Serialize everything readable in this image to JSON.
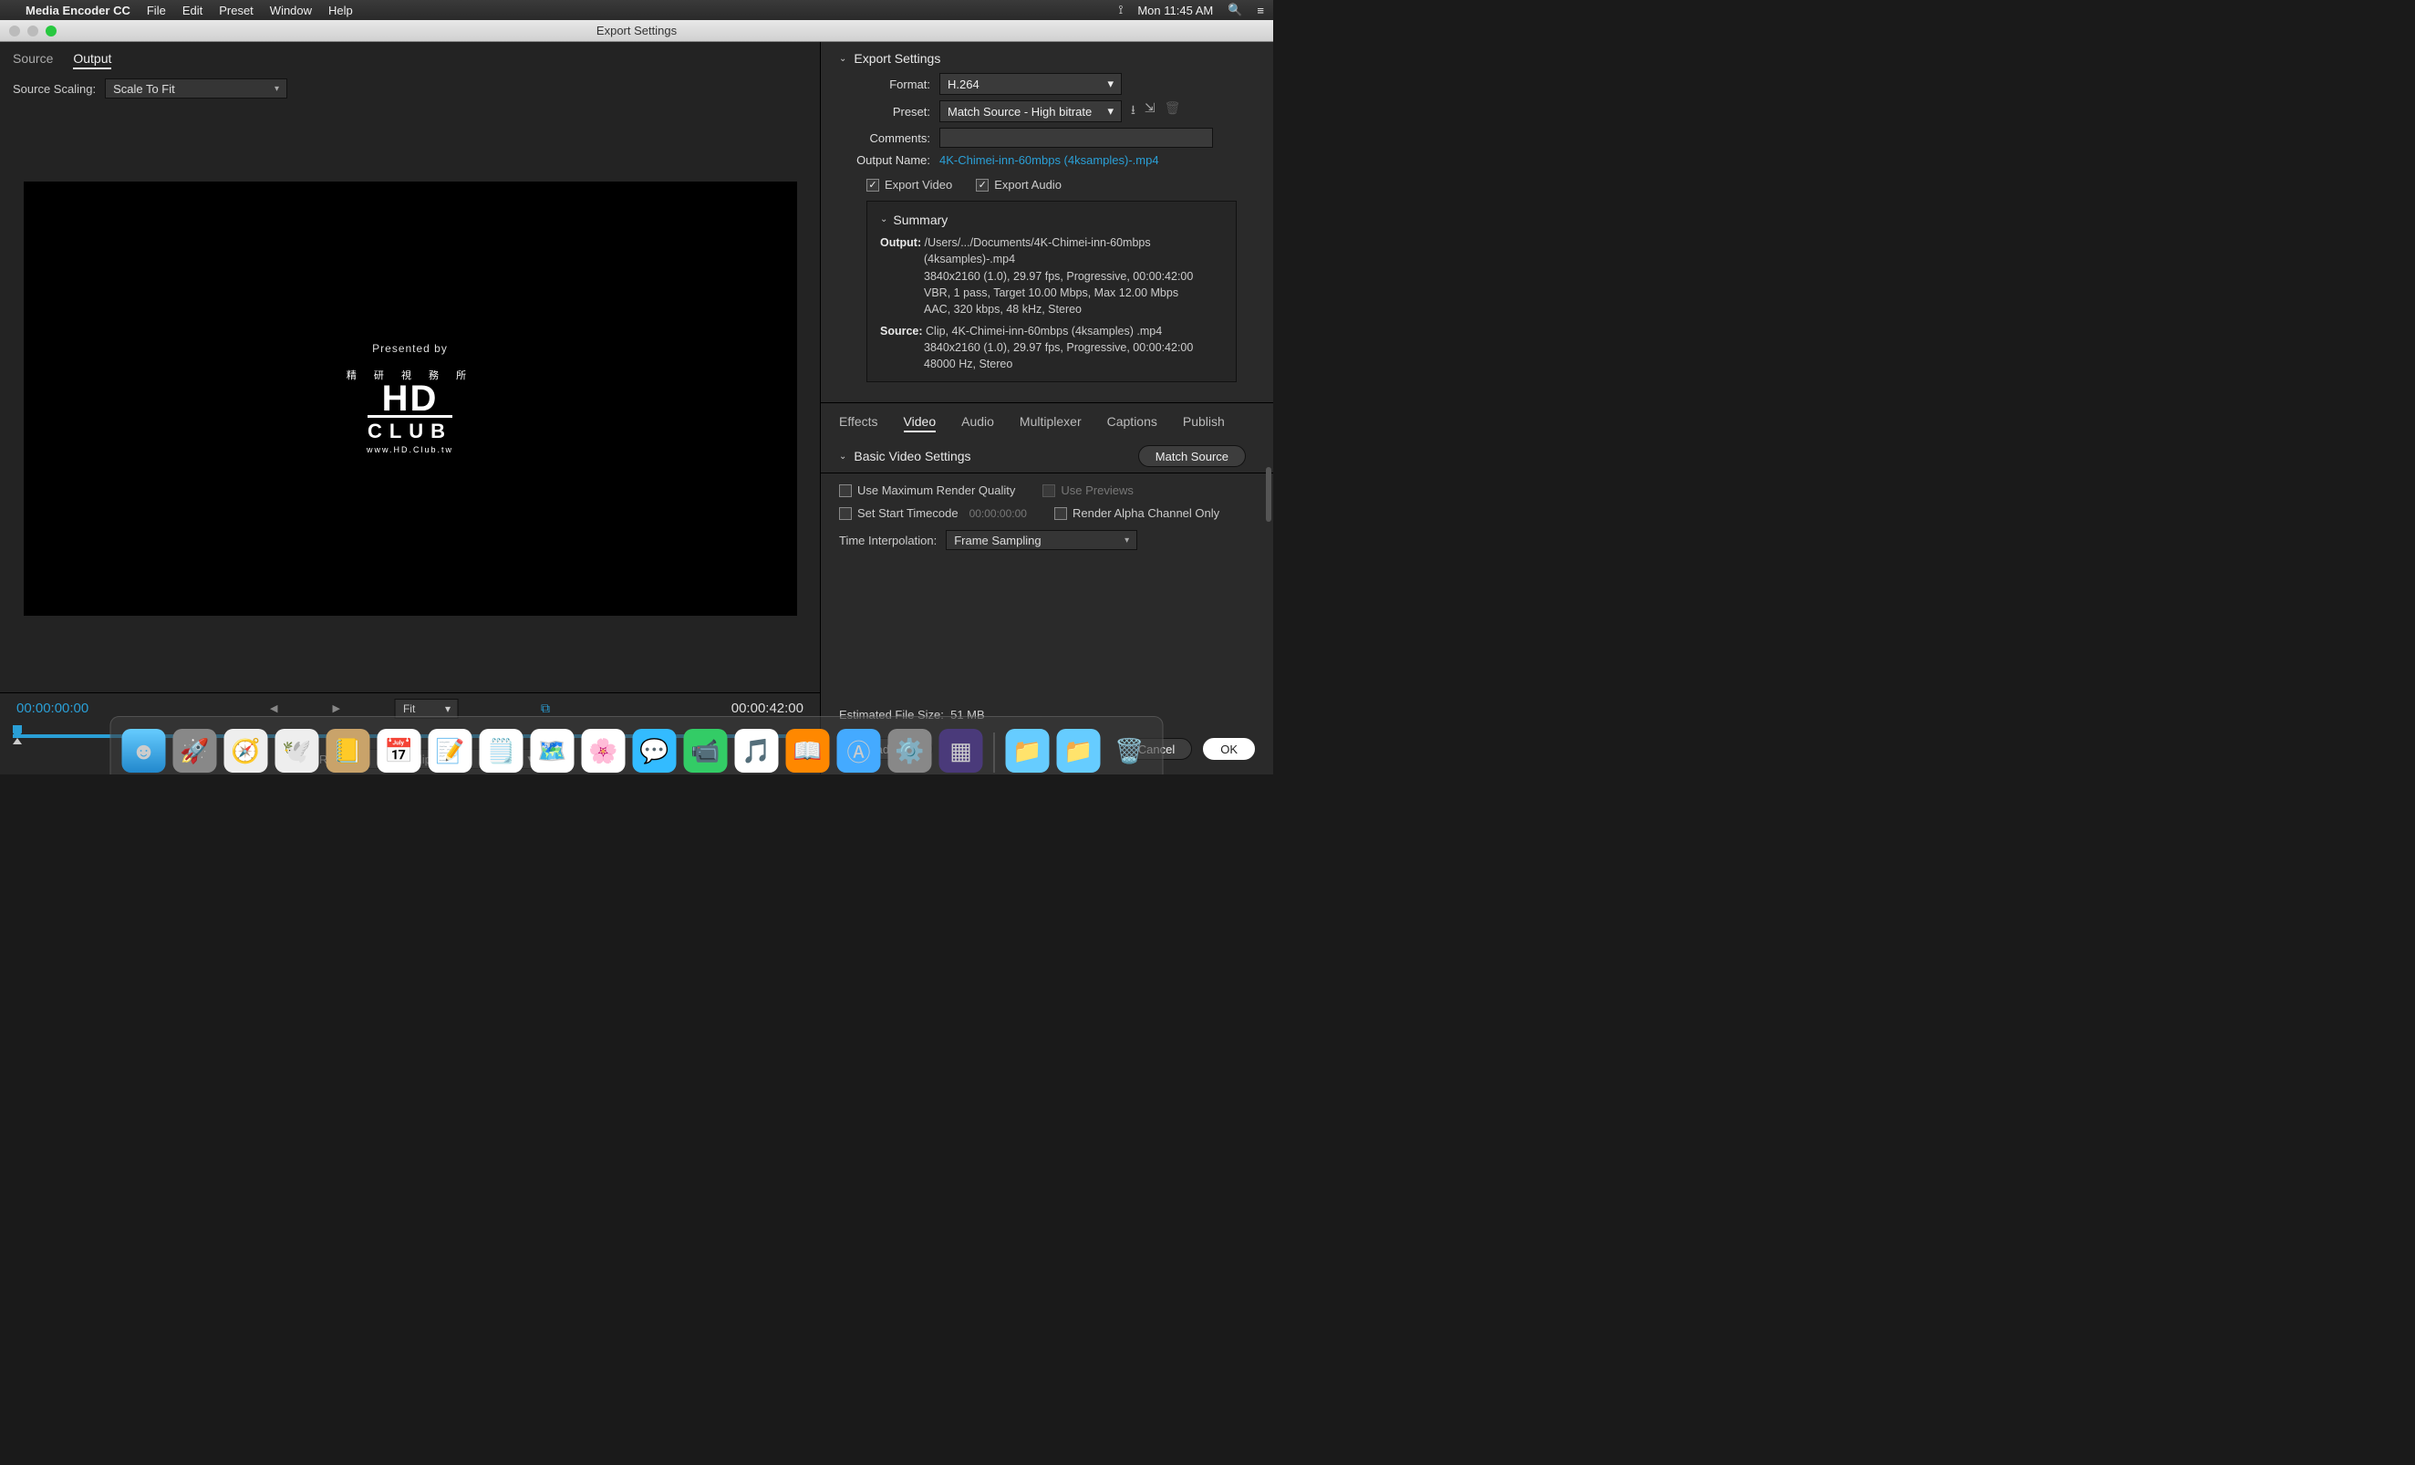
{
  "menubar": {
    "app": "Media Encoder CC",
    "items": [
      "File",
      "Edit",
      "Preset",
      "Window",
      "Help"
    ],
    "clock": "Mon 11:45 AM"
  },
  "window": {
    "title": "Export Settings"
  },
  "leftPane": {
    "tabs": [
      "Source",
      "Output"
    ],
    "activeTab": 1,
    "scalingLabel": "Source Scaling:",
    "scalingValue": "Scale To Fit",
    "preview": {
      "presented": "Presented by",
      "cjk": "精 研 視 務 所",
      "line1": "HD",
      "line2": "CLUB",
      "url": "www.HD.Club.tw"
    },
    "transport": {
      "inTC": "00:00:00:00",
      "outTC": "00:00:42:00",
      "fit": "Fit",
      "sourceRangeLabel": "Source Range:",
      "sourceRangeValue": "Entire Clip"
    }
  },
  "export": {
    "heading": "Export Settings",
    "formatLabel": "Format:",
    "formatValue": "H.264",
    "presetLabel": "Preset:",
    "presetValue": "Match Source - High bitrate",
    "commentsLabel": "Comments:",
    "commentsValue": "",
    "outputNameLabel": "Output Name:",
    "outputNameValue": "4K-Chimei-inn-60mbps (4ksamples)-.mp4",
    "exportVideo": "Export Video",
    "exportAudio": "Export Audio"
  },
  "summary": {
    "heading": "Summary",
    "outputLabel": "Output:",
    "output1": "/Users/.../Documents/4K-Chimei-inn-60mbps (4ksamples)-.mp4",
    "output2": "3840x2160 (1.0), 29.97 fps, Progressive, 00:00:42:00",
    "output3": "VBR, 1 pass, Target 10.00 Mbps, Max 12.00 Mbps",
    "output4": "AAC, 320 kbps, 48 kHz, Stereo",
    "sourceLabel": "Source:",
    "source1": "Clip, 4K-Chimei-inn-60mbps (4ksamples) .mp4",
    "source2": "3840x2160 (1.0), 29.97 fps, Progressive, 00:00:42:00",
    "source3": "48000 Hz, Stereo"
  },
  "subtabs": [
    "Effects",
    "Video",
    "Audio",
    "Multiplexer",
    "Captions",
    "Publish"
  ],
  "subtabActive": 1,
  "basic": {
    "heading": "Basic Video Settings",
    "matchBtn": "Match Source"
  },
  "render": {
    "maxQuality": "Use Maximum Render Quality",
    "usePreviews": "Use Previews",
    "setStartTC": "Set Start Timecode",
    "startTCValue": "00:00:00:00",
    "renderAlpha": "Render Alpha Channel Only",
    "interpLabel": "Time Interpolation:",
    "interpValue": "Frame Sampling"
  },
  "footer": {
    "efsLabel": "Estimated File Size:",
    "efsValue": "51 MB",
    "metadata": "Metadata...",
    "cancel": "Cancel",
    "ok": "OK"
  },
  "dock": [
    "🔵",
    "🚀",
    "🧭",
    "✉️",
    "📒",
    "📅",
    "📝",
    "🗒️",
    "🗓️",
    "🌸",
    "💬",
    "📹",
    "🎵",
    "📖",
    "🛒",
    "⚙️",
    "🎬",
    "📁",
    "📁",
    "🗑️"
  ]
}
